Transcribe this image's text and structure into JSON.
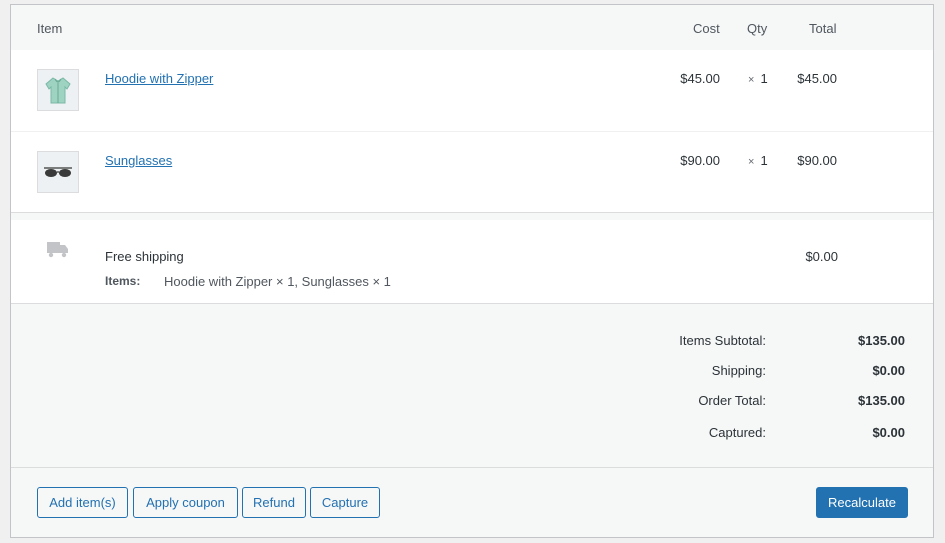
{
  "table": {
    "headers": {
      "item": "Item",
      "cost": "Cost",
      "qty": "Qty",
      "total": "Total"
    }
  },
  "items": [
    {
      "name": "Hoodie with Zipper",
      "cost": "$45.00",
      "qty_symbol": "×",
      "qty": "1",
      "total": "$45.00",
      "thumb_icon": "hoodie-icon"
    },
    {
      "name": "Sunglasses",
      "cost": "$90.00",
      "qty_symbol": "×",
      "qty": "1",
      "total": "$90.00",
      "thumb_icon": "sunglasses-icon"
    }
  ],
  "shipping": {
    "method": "Free shipping",
    "items_label": "Items:",
    "items_value": "Hoodie with Zipper × 1, Sunglasses × 1",
    "cost": "$0.00",
    "icon": "truck-icon"
  },
  "totals": {
    "subtotal_label": "Items Subtotal:",
    "subtotal_value": "$135.00",
    "shipping_label": "Shipping:",
    "shipping_value": "$0.00",
    "order_total_label": "Order Total:",
    "order_total_value": "$135.00",
    "captured_label": "Captured:",
    "captured_value": "$0.00"
  },
  "actions": {
    "add_items": "Add item(s)",
    "apply_coupon": "Apply coupon",
    "refund": "Refund",
    "capture": "Capture",
    "recalculate": "Recalculate"
  },
  "colors": {
    "accent": "#2271b1",
    "panel_bg": "#f6f7f7"
  }
}
